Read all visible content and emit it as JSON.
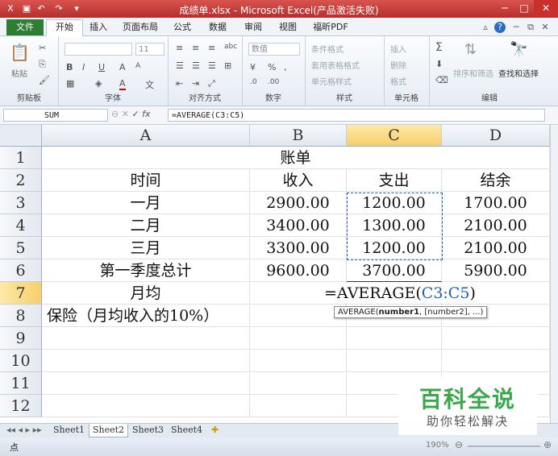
{
  "window": {
    "title": "成绩单.xlsx - Microsoft Excel(产品激活失败)"
  },
  "ribbon_tabs": [
    "文件",
    "开始",
    "插入",
    "页面布局",
    "公式",
    "数据",
    "审阅",
    "视图",
    "福昕PDF"
  ],
  "ribbon": {
    "clipboard": {
      "paste": "粘贴",
      "label": "剪贴板"
    },
    "font": {
      "size": "11",
      "label": "字体",
      "bold": "B",
      "italic": "I",
      "underline": "U",
      "font_color": "A",
      "grow": "A",
      "shrink": "A"
    },
    "alignment": {
      "label": "对齐方式",
      "wrap": "abc"
    },
    "number": {
      "format": "数值",
      "percent": "%",
      "comma": ",",
      "label": "数字"
    },
    "styles": {
      "conditional": "条件格式",
      "table": "套用表格格式",
      "cell": "单元格样式",
      "label": "样式"
    },
    "cells": {
      "insert": "插入",
      "delete": "删除",
      "format": "格式",
      "label": "单元格"
    },
    "editing": {
      "sort": "排序和筛选",
      "find": "查找和选择",
      "label": "编辑"
    }
  },
  "formula_bar": {
    "name_box": "SUM",
    "fx": "fx",
    "formula": "=AVERAGE(C3:C5)"
  },
  "columns": [
    "A",
    "B",
    "C",
    "D"
  ],
  "rows": [
    "1",
    "2",
    "3",
    "4",
    "5",
    "6",
    "7",
    "8",
    "9",
    "10",
    "11",
    "12"
  ],
  "cells": {
    "title": "账单",
    "h_time": "时间",
    "h_income": "收入",
    "h_expense": "支出",
    "h_balance": "结余",
    "r3": [
      "一月",
      "2900.00",
      "1200.00",
      "1700.00"
    ],
    "r4": [
      "二月",
      "3400.00",
      "1300.00",
      "2100.00"
    ],
    "r5": [
      "三月",
      "3300.00",
      "1200.00",
      "2100.00"
    ],
    "r6": [
      "第一季度总计",
      "9600.00",
      "3700.00",
      "5900.00"
    ],
    "r7a": "月均",
    "r8a": "保险（月均收入的10%）"
  },
  "editing_formula": {
    "prefix": "=AVERAGE(",
    "ref": "C3:C5",
    "suffix": ")"
  },
  "tooltip": {
    "fn": "AVERAGE(",
    "arg1": "number1",
    "rest": ", [number2], ...)"
  },
  "sheets": [
    "Sheet1",
    "Sheet2",
    "Sheet3",
    "Sheet4"
  ],
  "active_sheet": "Sheet2",
  "status": {
    "mode": "点",
    "zoom": "190%"
  },
  "watermark": {
    "title": "百科全说",
    "subtitle": "助你轻松解决"
  }
}
